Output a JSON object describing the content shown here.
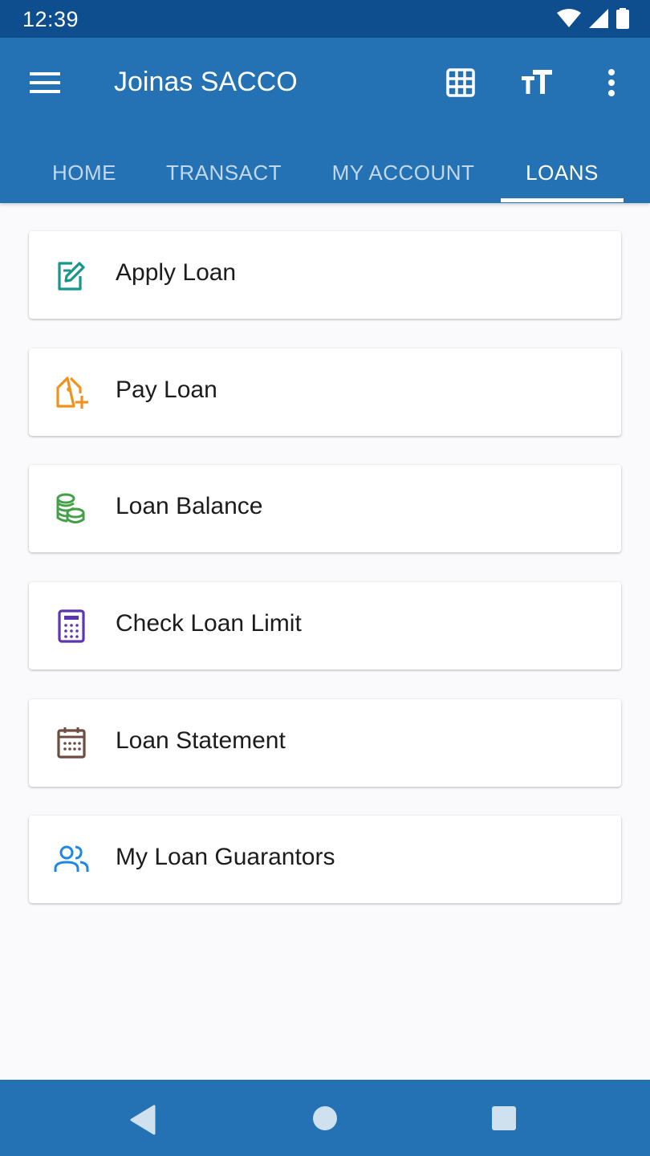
{
  "status_bar": {
    "time": "12:39"
  },
  "app_bar": {
    "title": "Joinas SACCO",
    "background_color": "#2472b4",
    "status_color": "#0f4e8e"
  },
  "tabs": [
    {
      "label": "HOME",
      "active": false
    },
    {
      "label": "TRANSACT",
      "active": false
    },
    {
      "label": "MY ACCOUNT",
      "active": false
    },
    {
      "label": "LOANS",
      "active": true
    }
  ],
  "menu_items": [
    {
      "label": "Apply Loan",
      "icon": "edit-document-icon",
      "color": "#16978c"
    },
    {
      "label": "Pay Loan",
      "icon": "tag-plus-icon",
      "color": "#f0921e"
    },
    {
      "label": "Loan Balance",
      "icon": "coins-icon",
      "color": "#43a047"
    },
    {
      "label": "Check Loan Limit",
      "icon": "calculator-icon",
      "color": "#5e35b1"
    },
    {
      "label": "Loan Statement",
      "icon": "calendar-icon",
      "color": "#6d4c41"
    },
    {
      "label": "My Loan Guarantors",
      "icon": "people-icon",
      "color": "#1e88e5"
    }
  ]
}
